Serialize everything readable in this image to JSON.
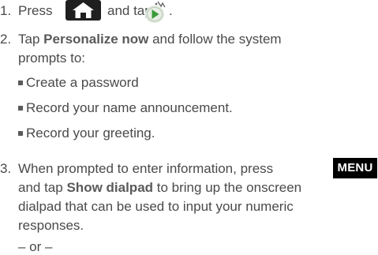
{
  "step1": {
    "number": "1.",
    "press": "Press",
    "and_tap": "and tap",
    "period": "."
  },
  "step2": {
    "number": "2.",
    "tap": "Tap",
    "personalize": "Personalize now",
    "line1_rest": "and follow the system",
    "line2": "prompts to:",
    "bullets": [
      "Create a password",
      "Record your name announcement.",
      "Record your greeting."
    ]
  },
  "step3": {
    "number": "3.",
    "line1": "When prompted to enter information, press",
    "menu_key": "MENU",
    "line2_and_tap": "and tap",
    "show_dialpad": "Show dialpad",
    "line2_rest": "to bring up the onscreen",
    "line3": "dialpad that can be used to input your numeric",
    "line4": "responses."
  },
  "or_separator": "– or –",
  "icons": {
    "home_key": "home-key-icon",
    "voicemail_app": "voicemail-play-icon"
  },
  "colors": {
    "text": "#4a4a4a",
    "key_background": "#1f1f1f",
    "menu_key_background": "#000000",
    "menu_key_text": "#ffffff",
    "play_icon_green": "#3a9a3a"
  }
}
